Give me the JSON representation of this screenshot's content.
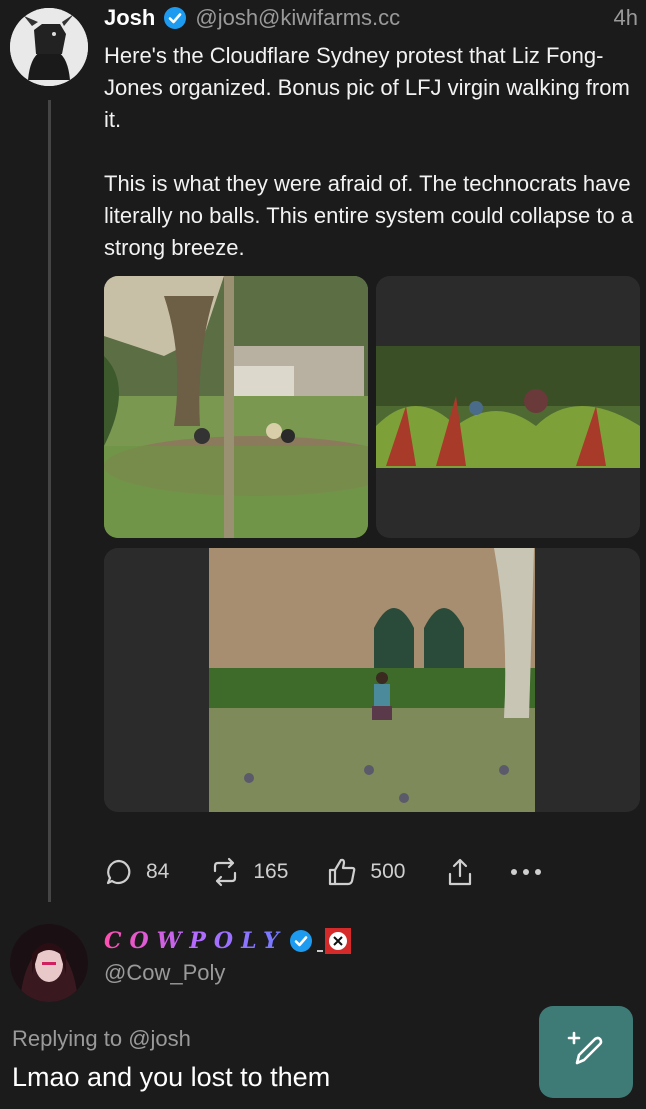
{
  "post": {
    "author_name": "Josh",
    "author_handle": "@josh@kiwifarms.cc",
    "time": "4h",
    "text": "Here's the Cloudflare Sydney protest that Liz Fong-Jones organized. Bonus pic of LFJ virgin walking from it.\n\nThis is what they were afraid of. The technocrats have literally no balls. This entire system could collapse to a strong breeze.",
    "images": [
      "park-photo-1",
      "park-photo-2",
      "park-photo-3"
    ],
    "actions": {
      "replies": "84",
      "reposts": "165",
      "likes": "500"
    }
  },
  "reply": {
    "author_name": "COWPOLY",
    "author_handle": "@Cow_Poly",
    "replying_label": "Replying to",
    "replying_to": "@josh",
    "text": "Lmao and you lost to them"
  },
  "colors": {
    "background": "#1b1b1b",
    "verified": "#1d9bf0",
    "fab": "#3e7b76"
  }
}
